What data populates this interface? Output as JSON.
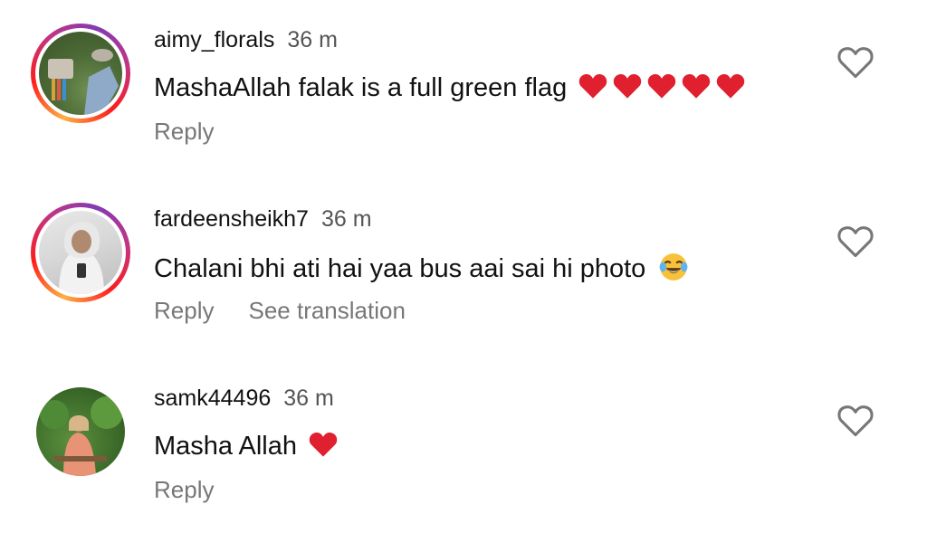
{
  "comments": [
    {
      "username": "aimy_florals",
      "time": "36 m",
      "text": "MashaAllah falak is a full green flag",
      "emoji": [
        "red-heart",
        "red-heart",
        "red-heart",
        "red-heart",
        "red-heart"
      ],
      "actions": [
        "Reply"
      ],
      "has_story_ring": true
    },
    {
      "username": "fardeensheikh7",
      "time": "36 m",
      "text": "Chalani bhi ati hai yaa bus aai sai hi photo ",
      "emoji": [
        "face-with-tears-of-joy"
      ],
      "actions": [
        "Reply",
        "See translation"
      ],
      "has_story_ring": true
    },
    {
      "username": "samk44496",
      "time": "36 m",
      "text": "Masha Allah ",
      "emoji": [
        "red-heart"
      ],
      "actions": [
        "Reply"
      ],
      "has_story_ring": false
    }
  ],
  "colors": {
    "heart": "#e0202f",
    "ring_start": "#fcb045",
    "ring_end": "#c13584",
    "muted": "#777777"
  },
  "icons": {
    "like": "heart-outline-icon"
  }
}
